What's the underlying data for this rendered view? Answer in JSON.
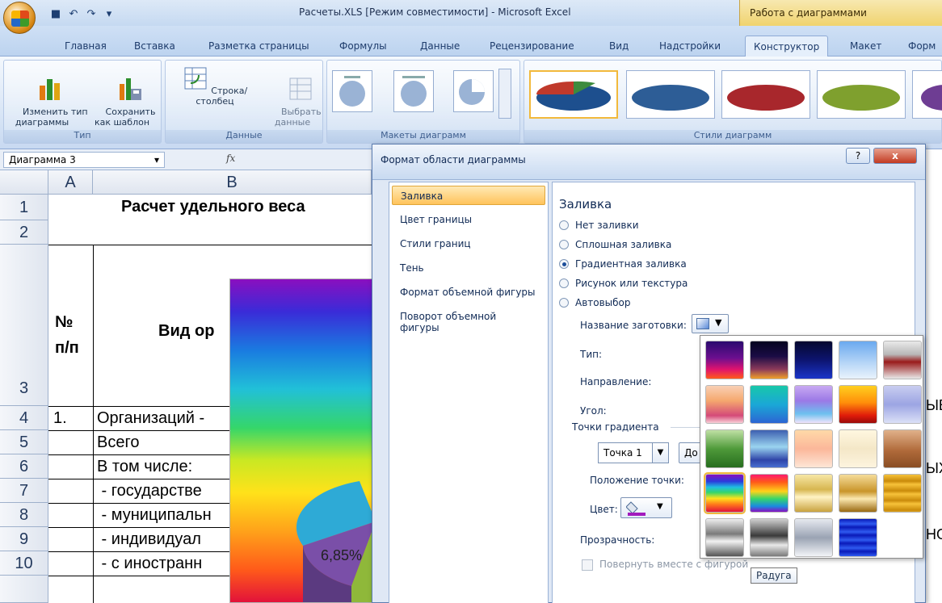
{
  "title": "Расчеты.XLS [Режим совместимости] - Microsoft Excel",
  "contextual_title": "Работа с диаграммами",
  "tabs": [
    "Главная",
    "Вставка",
    "Разметка страницы",
    "Формулы",
    "Данные",
    "Рецензирование",
    "Вид",
    "Надстройки",
    "Конструктор",
    "Макет",
    "Форм"
  ],
  "ribbon": {
    "change_type": "Изменить тип\nдиаграммы",
    "save_template": "Сохранить\nкак шаблон",
    "group_type": "Тип",
    "row_col": "Строка/столбец",
    "select_data": "Выбрать\nданные",
    "group_data": "Данные",
    "group_layouts": "Макеты диаграмм",
    "group_styles": "Стили диаграмм"
  },
  "namebox": "Диаграмма 3",
  "fx": "fx",
  "grid": {
    "col_a": "A",
    "col_b": "B",
    "rows": [
      "1",
      "2",
      "3",
      "4",
      "5",
      "6",
      "7",
      "8",
      "9",
      "10"
    ],
    "title_cell": "Расчет удельного веса",
    "hdr_num": "№\nп/п",
    "hdr_kind": "Вид ор",
    "r4a": "1.",
    "r4b": "Организаций -",
    "r5b": "Всего",
    "r6b": "В том числе:",
    "r7b": " - государстве",
    "r8b": " - муниципальн",
    "r9b": " - индивидуал",
    "r10b": " - с иностранн"
  },
  "chart": {
    "label": "6,85%"
  },
  "dialog": {
    "title": "Формат области диаграммы",
    "help": "?",
    "close": "x",
    "nav": [
      "Заливка",
      "Цвет границы",
      "Стили границ",
      "Тень",
      "Формат объемной фигуры",
      "Поворот объемной фигуры"
    ],
    "section": "Заливка",
    "radios": [
      "Нет заливки",
      "Сплошная заливка",
      "Градиентная заливка",
      "Рисунок или текстура",
      "Автовыбор"
    ],
    "preset_label": "Название заготовки:",
    "type_label": "Тип:",
    "direction_label": "Направление:",
    "angle_label": "Угол:",
    "stops_label": "Точки градиента",
    "stop_value": "Точка 1",
    "add_btn": "До",
    "position_label": "Положение точки:",
    "color_label": "Цвет:",
    "transparency_label": "Прозрачность:",
    "rotate_label": "Повернуть вместе с фигурой"
  },
  "tooltip": "Радуга",
  "edge_text": [
    "ЫЕ",
    "ЫХ",
    "НО"
  ]
}
